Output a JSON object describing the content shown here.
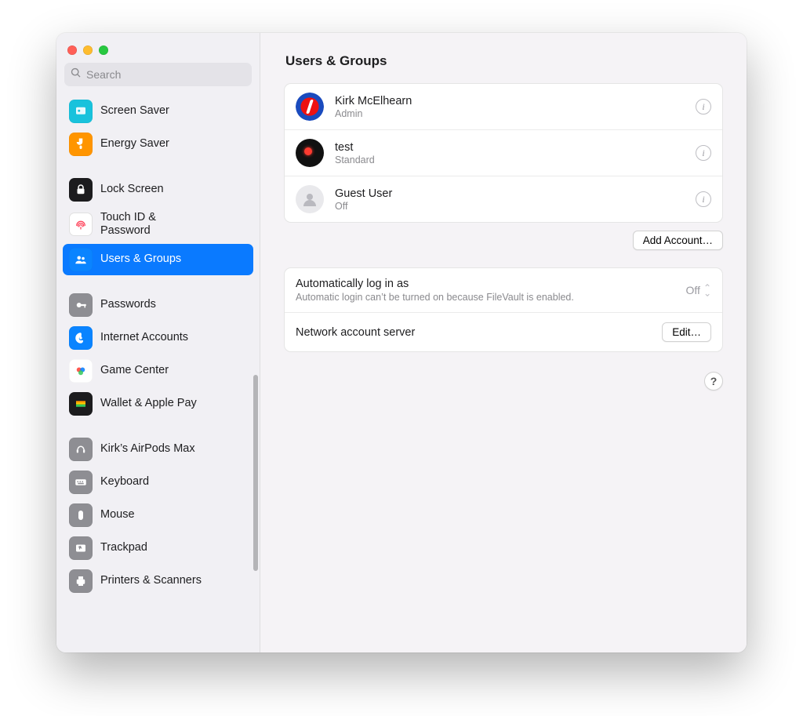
{
  "search": {
    "placeholder": "Search"
  },
  "page": {
    "title": "Users & Groups"
  },
  "sidebar": {
    "groups": [
      {
        "items": [
          {
            "label": "Screen Saver"
          },
          {
            "label": "Energy Saver"
          }
        ]
      },
      {
        "items": [
          {
            "label": "Lock Screen"
          },
          {
            "label1": "Touch ID &",
            "label2": "Password"
          },
          {
            "label": "Users & Groups"
          }
        ]
      },
      {
        "items": [
          {
            "label": "Passwords"
          },
          {
            "label": "Internet Accounts"
          },
          {
            "label": "Game Center"
          },
          {
            "label": "Wallet & Apple Pay"
          }
        ]
      },
      {
        "items": [
          {
            "label": "Kirk’s AirPods Max"
          },
          {
            "label": "Keyboard"
          },
          {
            "label": "Mouse"
          },
          {
            "label": "Trackpad"
          },
          {
            "label": "Printers & Scanners"
          }
        ]
      }
    ]
  },
  "users": [
    {
      "name": "Kirk McElhearn",
      "sub": "Admin"
    },
    {
      "name": "test",
      "sub": "Standard"
    },
    {
      "name": "Guest User",
      "sub": "Off"
    }
  ],
  "buttons": {
    "addAccount": "Add Account…",
    "edit": "Edit…",
    "help": "?"
  },
  "settings": {
    "autoLoginTitle": "Automatically log in as",
    "autoLoginValue": "Off",
    "autoLoginNote": "Automatic login can’t be turned on because FileVault is enabled.",
    "netServerTitle": "Network account server"
  }
}
